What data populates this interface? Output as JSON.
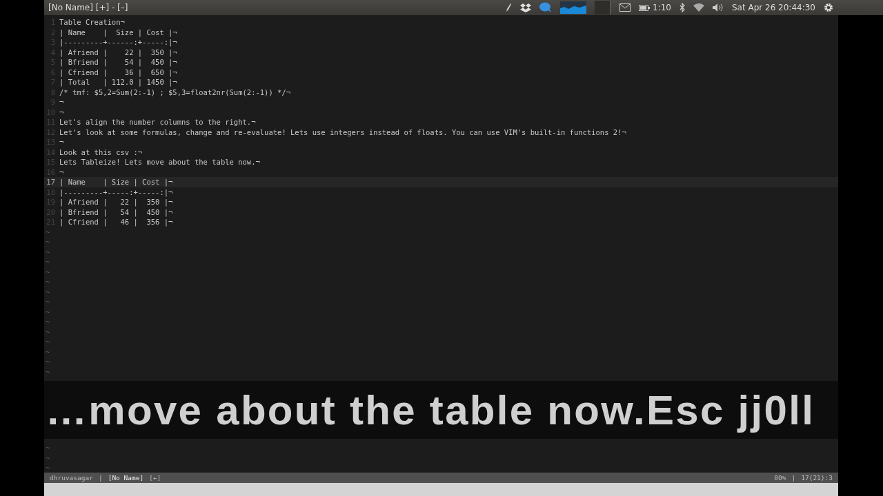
{
  "top_bar": {
    "title": "[No Name] [+] - [–]",
    "battery": "1:10",
    "clock": "Sat Apr 26  20:44:30"
  },
  "lines": [
    {
      "number": "1",
      "text": "Table Creation¬",
      "current": false
    },
    {
      "number": "2",
      "text": "| Name    |  Size | Cost |¬",
      "current": false
    },
    {
      "number": "3",
      "text": "|---------+------:+-----:|¬",
      "current": false
    },
    {
      "number": "4",
      "text": "| Afriend |    22 |  350 |¬",
      "current": false
    },
    {
      "number": "5",
      "text": "| Bfriend |    54 |  450 |¬",
      "current": false
    },
    {
      "number": "6",
      "text": "| Cfriend |    36 |  650 |¬",
      "current": false
    },
    {
      "number": "7",
      "text": "| Total   | 112.0 | 1450 |¬",
      "current": false
    },
    {
      "number": "8",
      "text": "/* tmf: $5,2=Sum(2:-1) ; $5,3=float2nr(Sum(2:-1)) */¬",
      "current": false
    },
    {
      "number": "9",
      "text": "¬",
      "current": false
    },
    {
      "number": "10",
      "text": "¬",
      "current": false
    },
    {
      "number": "11",
      "text": "Let's align the number columns to the right.¬",
      "current": false
    },
    {
      "number": "12",
      "text": "Let's look at some formulas, change and re-evaluate! Lets use integers instead of floats. You can use VIM's built-in functions 2!¬",
      "current": false
    },
    {
      "number": "13",
      "text": "¬",
      "current": false
    },
    {
      "number": "14",
      "text": "Look at this csv :¬",
      "current": false
    },
    {
      "number": "15",
      "text": "Lets Tableize! Lets move about the table now.¬",
      "current": false
    },
    {
      "number": "16",
      "text": "¬",
      "current": false
    },
    {
      "number": "17",
      "text": "| Name    | Size | Cost |¬",
      "current": true
    },
    {
      "number": "18",
      "text": "|---------+-----:+-----:|¬",
      "current": false
    },
    {
      "number": "19",
      "text": "| Afriend |   22 |  350 |¬",
      "current": false
    },
    {
      "number": "20",
      "text": "| Bfriend |   54 |  450 |¬",
      "current": false
    },
    {
      "number": "21",
      "text": "| Cfriend |   46 |  356 |¬",
      "current": false
    }
  ],
  "filler_above": [
    "~",
    "~",
    "~",
    "~",
    "~",
    "~",
    "~",
    "~",
    "~",
    "~",
    "~",
    "~",
    "~",
    "~",
    "~"
  ],
  "caption": "…move about the table now.Esc jj0ll",
  "filler_below": [
    "~",
    "~",
    "~"
  ],
  "status_line": {
    "user": "dhruvasagar",
    "separator_left": "|",
    "file": "[No Name]",
    "modified": "[+]",
    "percent": "80%",
    "separator_right": "|",
    "position": "17(21):3"
  }
}
